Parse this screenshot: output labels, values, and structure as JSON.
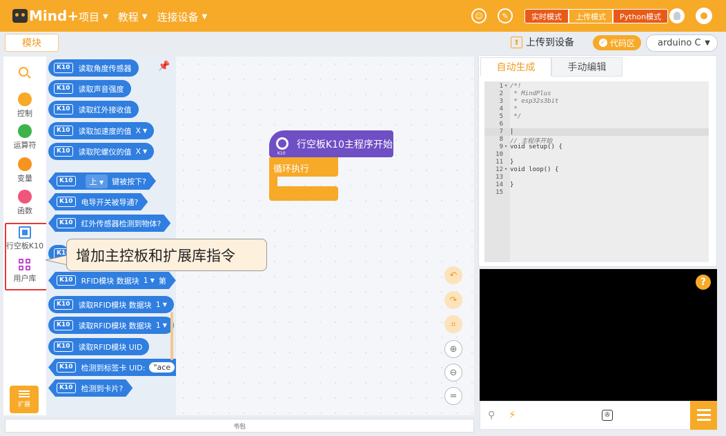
{
  "topbar": {
    "logo_text": "Mind+",
    "menu": [
      {
        "label": "项目"
      },
      {
        "label": "教程"
      },
      {
        "label": "连接设备"
      }
    ],
    "icon_a": "☺",
    "icon_b": "✎",
    "modes": [
      "实时模式",
      "上传模式",
      "Python模式"
    ],
    "active_mode": "上传模式"
  },
  "toolbar": {
    "module_tab": "模块",
    "upload_label": "上传到设备",
    "code_area_label": "代码区",
    "board_select": "arduino C"
  },
  "categories": [
    {
      "label": "控制",
      "color": "#f7a928"
    },
    {
      "label": "运算符",
      "color": "#3fb34b"
    },
    {
      "label": "变量",
      "color": "#f7941e"
    },
    {
      "label": "函数",
      "color": "#f0567a"
    },
    {
      "label": "行空板K10",
      "icon": "chip-icon"
    },
    {
      "label": "用户库",
      "icon": "library-icon"
    }
  ],
  "extension_label": "扩展",
  "blocks": {
    "k10_badge": "K10",
    "b1": "读取角度传感器",
    "b2": "读取声音强度",
    "b3": "读取红外接收值",
    "b4": "读取加速度的值",
    "b4_opt": "X",
    "b5": "读取陀螺仪的值",
    "b5_opt": "X",
    "b6_opt": "上",
    "b6": "键被按下?",
    "b7": "电导开关被导通?",
    "b8": "红外传感器检测到物体?",
    "b10": "RFID模块 数据块",
    "b10_num": "1",
    "b10_tail": "第",
    "b11": "读取RFID模块 数据块",
    "b11_num": "1",
    "b12": "读取RFID模块 数据块",
    "b12_num": "1",
    "b13": "读取RFID模块 UID",
    "b14": "检测到标签卡 UID:",
    "b14_val": "\"ace",
    "b15": "检测到卡片?"
  },
  "workspace": {
    "hat_block": "行空板K10主程序开始",
    "hat_sub": "K10",
    "loop_block": "循环执行"
  },
  "callout": "增加主控板和扩展库指令",
  "bag_label": "书包",
  "code_panel": {
    "tabs": [
      "自动生成",
      "手动编辑"
    ],
    "lines": [
      {
        "n": "1",
        "fold": "▾",
        "text": "/*!",
        "comment": true
      },
      {
        "n": "2",
        "fold": "",
        "text": " * MindPlus",
        "comment": true
      },
      {
        "n": "3",
        "fold": "",
        "text": " * esp32s3bit",
        "comment": true
      },
      {
        "n": "4",
        "fold": "",
        "text": " *",
        "comment": true
      },
      {
        "n": "5",
        "fold": "",
        "text": " */",
        "comment": true
      },
      {
        "n": "6",
        "fold": "",
        "text": "",
        "comment": false
      },
      {
        "n": "7",
        "fold": "",
        "text": "|",
        "comment": false
      },
      {
        "n": "8",
        "fold": "",
        "text": "// 主程序开始",
        "comment": true
      },
      {
        "n": "9",
        "fold": "▾",
        "text": "void setup() {",
        "comment": false
      },
      {
        "n": "10",
        "fold": "",
        "text": "",
        "comment": false
      },
      {
        "n": "11",
        "fold": "",
        "text": "}",
        "comment": false
      },
      {
        "n": "12",
        "fold": "▾",
        "text": "void loop() {",
        "comment": false
      },
      {
        "n": "13",
        "fold": "",
        "text": "",
        "comment": false
      },
      {
        "n": "14",
        "fold": "",
        "text": "}",
        "comment": false
      },
      {
        "n": "15",
        "fold": "",
        "text": "",
        "comment": false
      }
    ]
  },
  "serial": {
    "help": "?"
  }
}
